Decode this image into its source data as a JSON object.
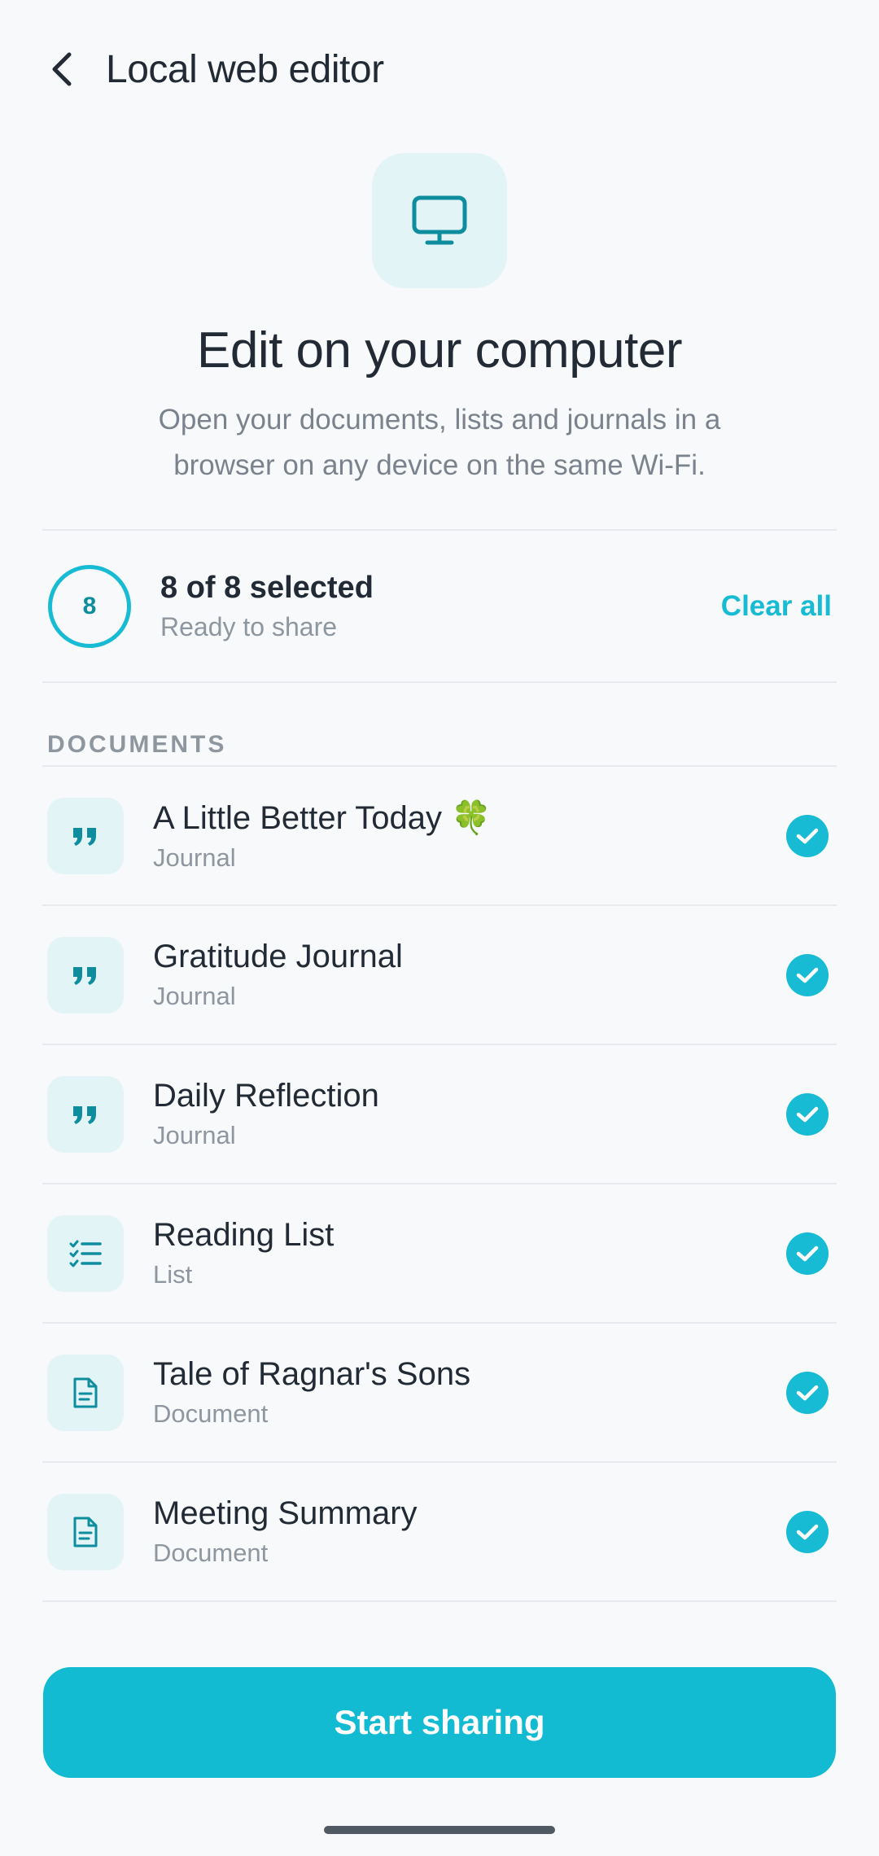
{
  "header": {
    "title": "Local web editor"
  },
  "hero": {
    "title": "Edit on your computer",
    "subtitle": "Open your documents, lists and journals in a browser on any device on the same Wi-Fi."
  },
  "selection": {
    "count": "8",
    "title": "8 of 8 selected",
    "subtitle": "Ready to share",
    "clear_label": "Clear all"
  },
  "section": {
    "label": "DOCUMENTS"
  },
  "documents": [
    {
      "title": "A Little Better Today 🍀",
      "type": "Journal",
      "icon": "quote-icon",
      "selected": true
    },
    {
      "title": "Gratitude Journal",
      "type": "Journal",
      "icon": "quote-icon",
      "selected": true
    },
    {
      "title": "Daily Reflection",
      "type": "Journal",
      "icon": "quote-icon",
      "selected": true
    },
    {
      "title": "Reading List",
      "type": "List",
      "icon": "checklist-icon",
      "selected": true
    },
    {
      "title": "Tale of Ragnar's Sons",
      "type": "Document",
      "icon": "document-icon",
      "selected": true
    },
    {
      "title": "Meeting Summary",
      "type": "Document",
      "icon": "document-icon",
      "selected": true
    }
  ],
  "footer": {
    "start_label": "Start sharing"
  },
  "colors": {
    "accent": "#17BBD3",
    "icon_bg": "#E3F4F7",
    "icon_fg": "#0E8D9E"
  }
}
